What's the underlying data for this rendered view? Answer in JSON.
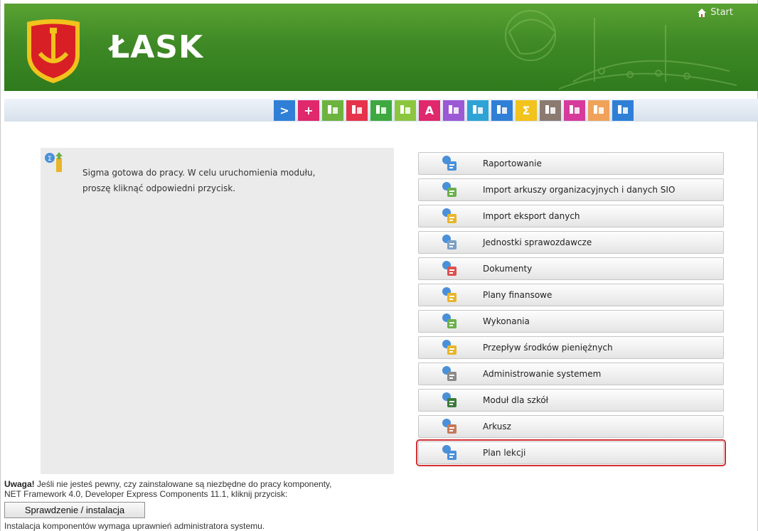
{
  "header": {
    "title": "ŁASK",
    "start_label": "Start"
  },
  "toolbar": {
    "tiles": [
      {
        "icon": "chevron-right-icon",
        "color": "#2f7fd6",
        "glyph": ">"
      },
      {
        "icon": "plus-icon",
        "color": "#e0286c",
        "glyph": "+"
      },
      {
        "icon": "list-transfer-icon",
        "color": "#6db33f",
        "glyph": ""
      },
      {
        "icon": "chart-growth-icon",
        "color": "#e5334b",
        "glyph": ""
      },
      {
        "icon": "people-group-icon",
        "color": "#3fa93f",
        "glyph": ""
      },
      {
        "icon": "books-icon",
        "color": "#8cc63f",
        "glyph": ""
      },
      {
        "icon": "text-cursor-icon",
        "color": "#e0286c",
        "glyph": "A"
      },
      {
        "icon": "face-icon",
        "color": "#9b59d6",
        "glyph": ""
      },
      {
        "icon": "stack-icon",
        "color": "#2ea3d6",
        "glyph": ""
      },
      {
        "icon": "documents-icon",
        "color": "#2f7fd6",
        "glyph": ""
      },
      {
        "icon": "sigma-icon",
        "color": "#f2c21d",
        "glyph": "Σ"
      },
      {
        "icon": "building-icon",
        "color": "#8a7a70",
        "glyph": ""
      },
      {
        "icon": "book-icon",
        "color": "#d63a9b",
        "glyph": ""
      },
      {
        "icon": "open-book-icon",
        "color": "#f0a25a",
        "glyph": ""
      },
      {
        "icon": "graduation-cap-icon",
        "color": "#2f7fd6",
        "glyph": ""
      }
    ]
  },
  "info": {
    "text_line1": "Sigma gotowa do pracy. W celu uruchomienia modułu,",
    "text_line2": "proszę kliknąć odpowiedni przycisk."
  },
  "modules": [
    {
      "label": "Raportowanie",
      "icon": "report-icon",
      "selected": false
    },
    {
      "label": "Import arkuszy organizacyjnych i danych SIO",
      "icon": "import-sio-icon",
      "selected": false
    },
    {
      "label": "Import eksport danych",
      "icon": "import-export-icon",
      "selected": false
    },
    {
      "label": "Jednostki sprawozdawcze",
      "icon": "units-icon",
      "selected": false
    },
    {
      "label": "Dokumenty",
      "icon": "documents-chart-icon",
      "selected": false
    },
    {
      "label": "Plany finansowe",
      "icon": "financial-plans-icon",
      "selected": false
    },
    {
      "label": "Wykonania",
      "icon": "execution-icon",
      "selected": false
    },
    {
      "label": "Przepływ środków pieniężnych",
      "icon": "cash-flow-icon",
      "selected": false
    },
    {
      "label": "Administrowanie systemem",
      "icon": "admin-gear-icon",
      "selected": false
    },
    {
      "label": "Moduł dla szkół",
      "icon": "school-board-icon",
      "selected": false
    },
    {
      "label": "Arkusz",
      "icon": "sheet-building-icon",
      "selected": false
    },
    {
      "label": "Plan lekcji",
      "icon": "lesson-plan-icon",
      "selected": true
    }
  ],
  "notice": {
    "bold": "Uwaga!",
    "line1_rest": " Jeśli nie jesteś pewny, czy zainstalowane są niezbędne do pracy komponenty,",
    "line2": "NET Framework 4.0, Developer Express Components 11.1, kliknij przycisk:",
    "button": "Sprawdzenie / instalacja",
    "admin_note": "Instalacja komponentów wymaga uprawnień administratora systemu."
  },
  "colors": {
    "header_green": "#3f8a26",
    "selected_outline": "#d22f35"
  }
}
